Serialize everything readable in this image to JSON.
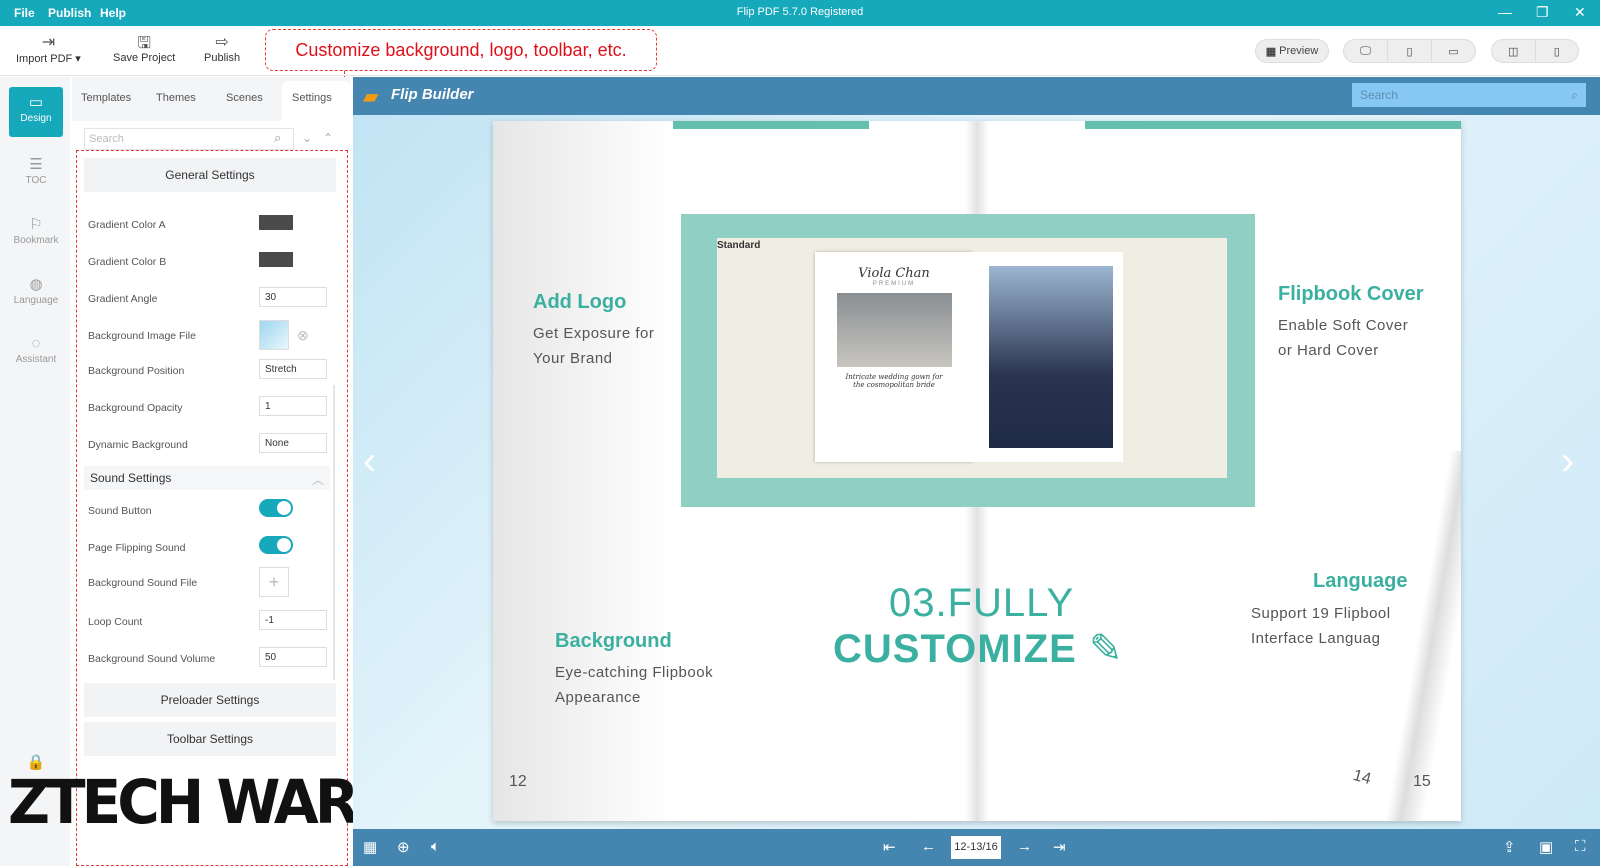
{
  "window": {
    "title": "Flip PDF 5.7.0  Registered",
    "menu": [
      "File",
      "Publish",
      "Help"
    ]
  },
  "toolbar": {
    "import": "Import PDF ▾",
    "save": "Save Project",
    "publish": "Publish",
    "preview": "Preview"
  },
  "callout": "Customize background, logo, toolbar, etc.",
  "rail": [
    "Design",
    "TOC",
    "Bookmark",
    "Language",
    "Assistant"
  ],
  "tabs": [
    "Templates",
    "Themes",
    "Scenes",
    "Settings"
  ],
  "search_placeholder": "Search",
  "sections": {
    "general": "General Settings",
    "sound": "Sound Settings",
    "preloader": "Preloader Settings",
    "toolbar": "Toolbar Settings"
  },
  "general_rows": [
    {
      "label": "Gradient Color A",
      "type": "color",
      "value": "#4a4a4a"
    },
    {
      "label": "Gradient Color B",
      "type": "color",
      "value": "#4a4a4a"
    },
    {
      "label": "Gradient Angle",
      "value": "30"
    },
    {
      "label": "Background Image File",
      "type": "image"
    },
    {
      "label": "Background Position",
      "value": "Stretch"
    },
    {
      "label": "Background Opacity",
      "value": "1"
    },
    {
      "label": "Dynamic Background",
      "value": "None"
    }
  ],
  "sound_rows": [
    {
      "label": "Sound Button",
      "toggle": true
    },
    {
      "label": "Page Flipping Sound",
      "toggle": true
    },
    {
      "label": "Background Sound File"
    },
    {
      "label": "Loop Count",
      "value": "-1"
    },
    {
      "label": "Background Sound Volume",
      "value": "50"
    }
  ],
  "flipbook": {
    "brand": "Flip Builder",
    "search": "Search",
    "page_indicator": "12-13/16",
    "left_page": 12,
    "right_page": 15,
    "curl_page": 14,
    "features": [
      {
        "title": "Add Logo",
        "desc": [
          "Get Exposure for",
          "Your Brand"
        ]
      },
      {
        "title": "Flipbook Cover",
        "desc": [
          "Enable Soft Cover",
          "or Hard Cover"
        ]
      },
      {
        "title": "Background",
        "desc": [
          "Eye-catching Flipbook",
          "Appearance"
        ]
      },
      {
        "title": "Language",
        "desc": [
          "Support 19 Flipbool",
          "Interface Languag"
        ]
      }
    ],
    "headline1": "03.FULLY",
    "headline2": "CUSTOMIZE",
    "inner": {
      "logo": "Standard",
      "brand": "Viola Chan",
      "sub": "PREMIUM",
      "caption": [
        "Intricate wedding gown for",
        "the cosmopolitan bride"
      ]
    }
  },
  "watermark": "ZTECHWAREZ",
  "colors": {
    "accent": "#16a8bb",
    "teal": "#3bb0a0",
    "flipbar": "#4486b0",
    "callout": "#e53935"
  }
}
